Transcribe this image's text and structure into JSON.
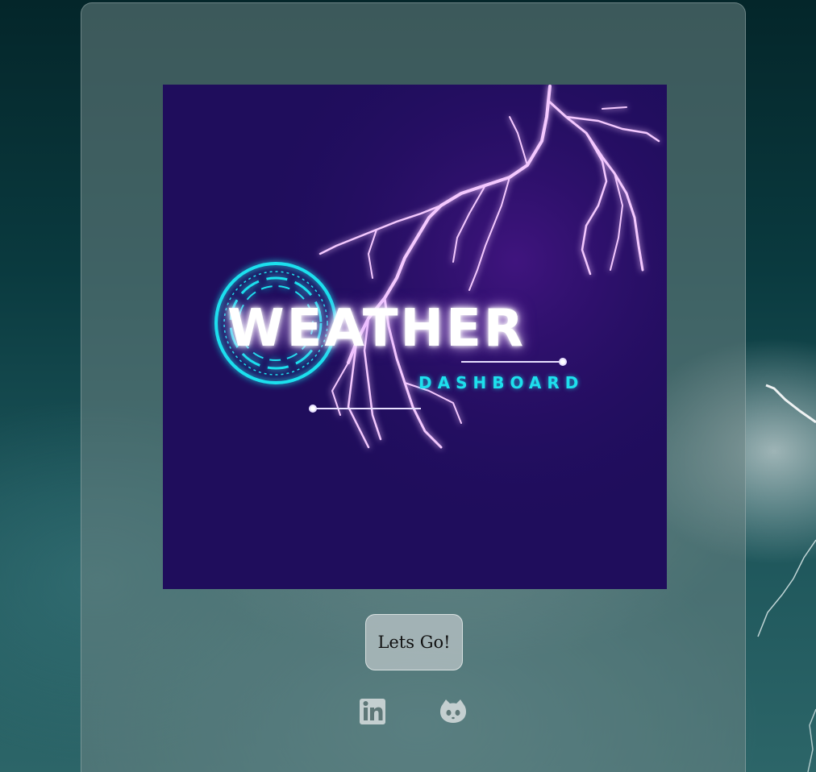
{
  "hero": {
    "title": "WEATHER",
    "subtitle": "DASHBOARD"
  },
  "actions": {
    "start_label": "Lets Go!"
  },
  "social": [
    {
      "icon": "linkedin-icon"
    },
    {
      "icon": "github-icon"
    }
  ],
  "colors": {
    "logo_background": "#1f0d5c",
    "lightning": "#e04cff",
    "accent_cyan": "#1ee0ee",
    "card_overlay": "#6c8484",
    "button_bg": "#afbcbe"
  }
}
